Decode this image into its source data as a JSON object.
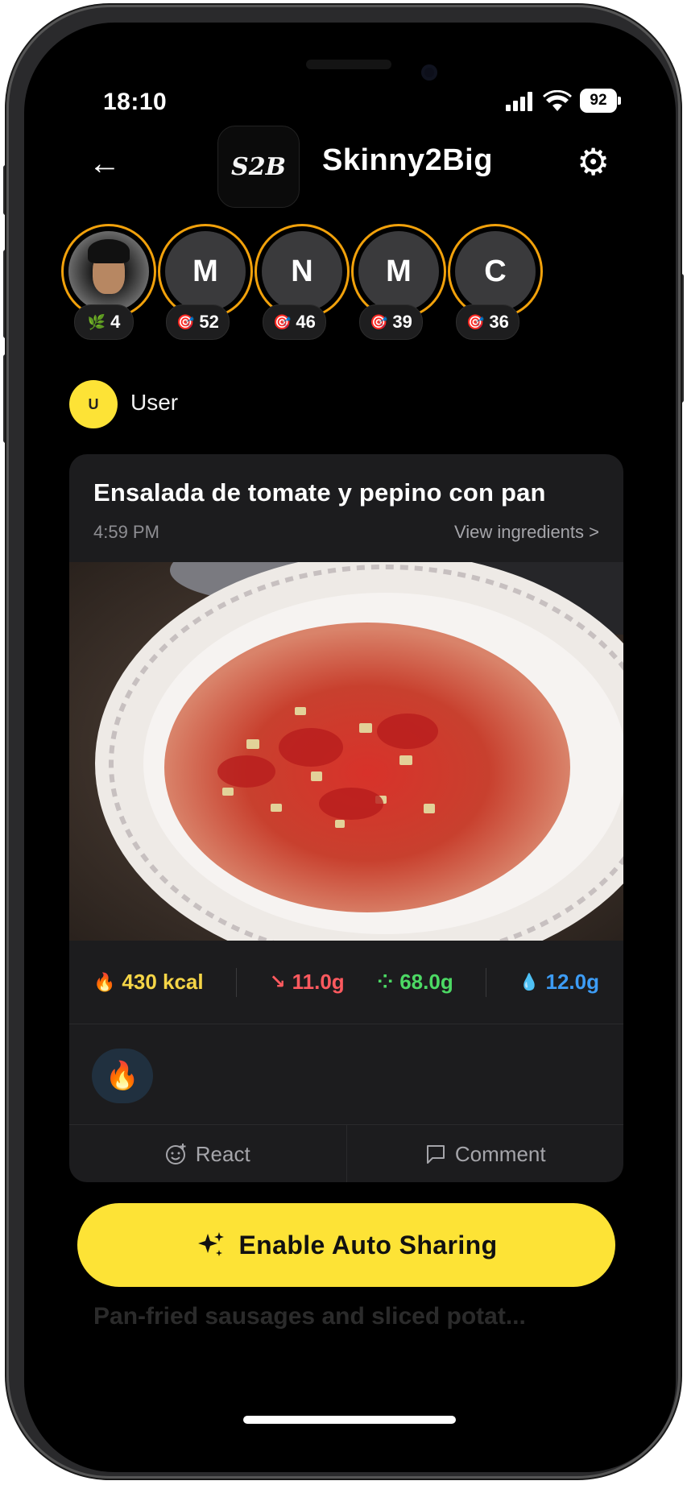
{
  "status_bar": {
    "time": "18:10",
    "battery": "92"
  },
  "header": {
    "back_glyph": "←",
    "logo_text": "S2B",
    "title": "Skinny2Big",
    "settings_glyph": "⚙"
  },
  "avatars": [
    {
      "initial": "",
      "has_photo": true,
      "badge_icon": "🌿",
      "badge_value": "4"
    },
    {
      "initial": "M",
      "has_photo": false,
      "badge_icon": "🎯",
      "badge_value": "52"
    },
    {
      "initial": "N",
      "has_photo": false,
      "badge_icon": "🎯",
      "badge_value": "46"
    },
    {
      "initial": "M",
      "has_photo": false,
      "badge_icon": "🎯",
      "badge_value": "39"
    },
    {
      "initial": "C",
      "has_photo": false,
      "badge_icon": "🎯",
      "badge_value": "36"
    }
  ],
  "post": {
    "user_initial": "U",
    "user_name": "User",
    "meal_title": "Ensalada de tomate y pepino con pan",
    "time": "4:59 PM",
    "view_ingredients": "View ingredients >",
    "macros": {
      "calories": {
        "value": "430 kcal",
        "color": "#f5d547",
        "icon": "🔥"
      },
      "protein": {
        "value": "11.0g",
        "color": "#ff5a5f",
        "icon": "↘"
      },
      "carbs": {
        "value": "68.0g",
        "color": "#4cd964",
        "icon": "⁘"
      },
      "fat": {
        "value": "12.0g",
        "color": "#3d9cf5",
        "icon": "💧"
      }
    },
    "reaction_emoji": "🔥",
    "react_label": "React",
    "comment_label": "Comment"
  },
  "cta": {
    "label": "Enable Auto Sharing",
    "color": "#fde336"
  },
  "next_post_preview": "Pan-fried sausages and sliced potat..."
}
